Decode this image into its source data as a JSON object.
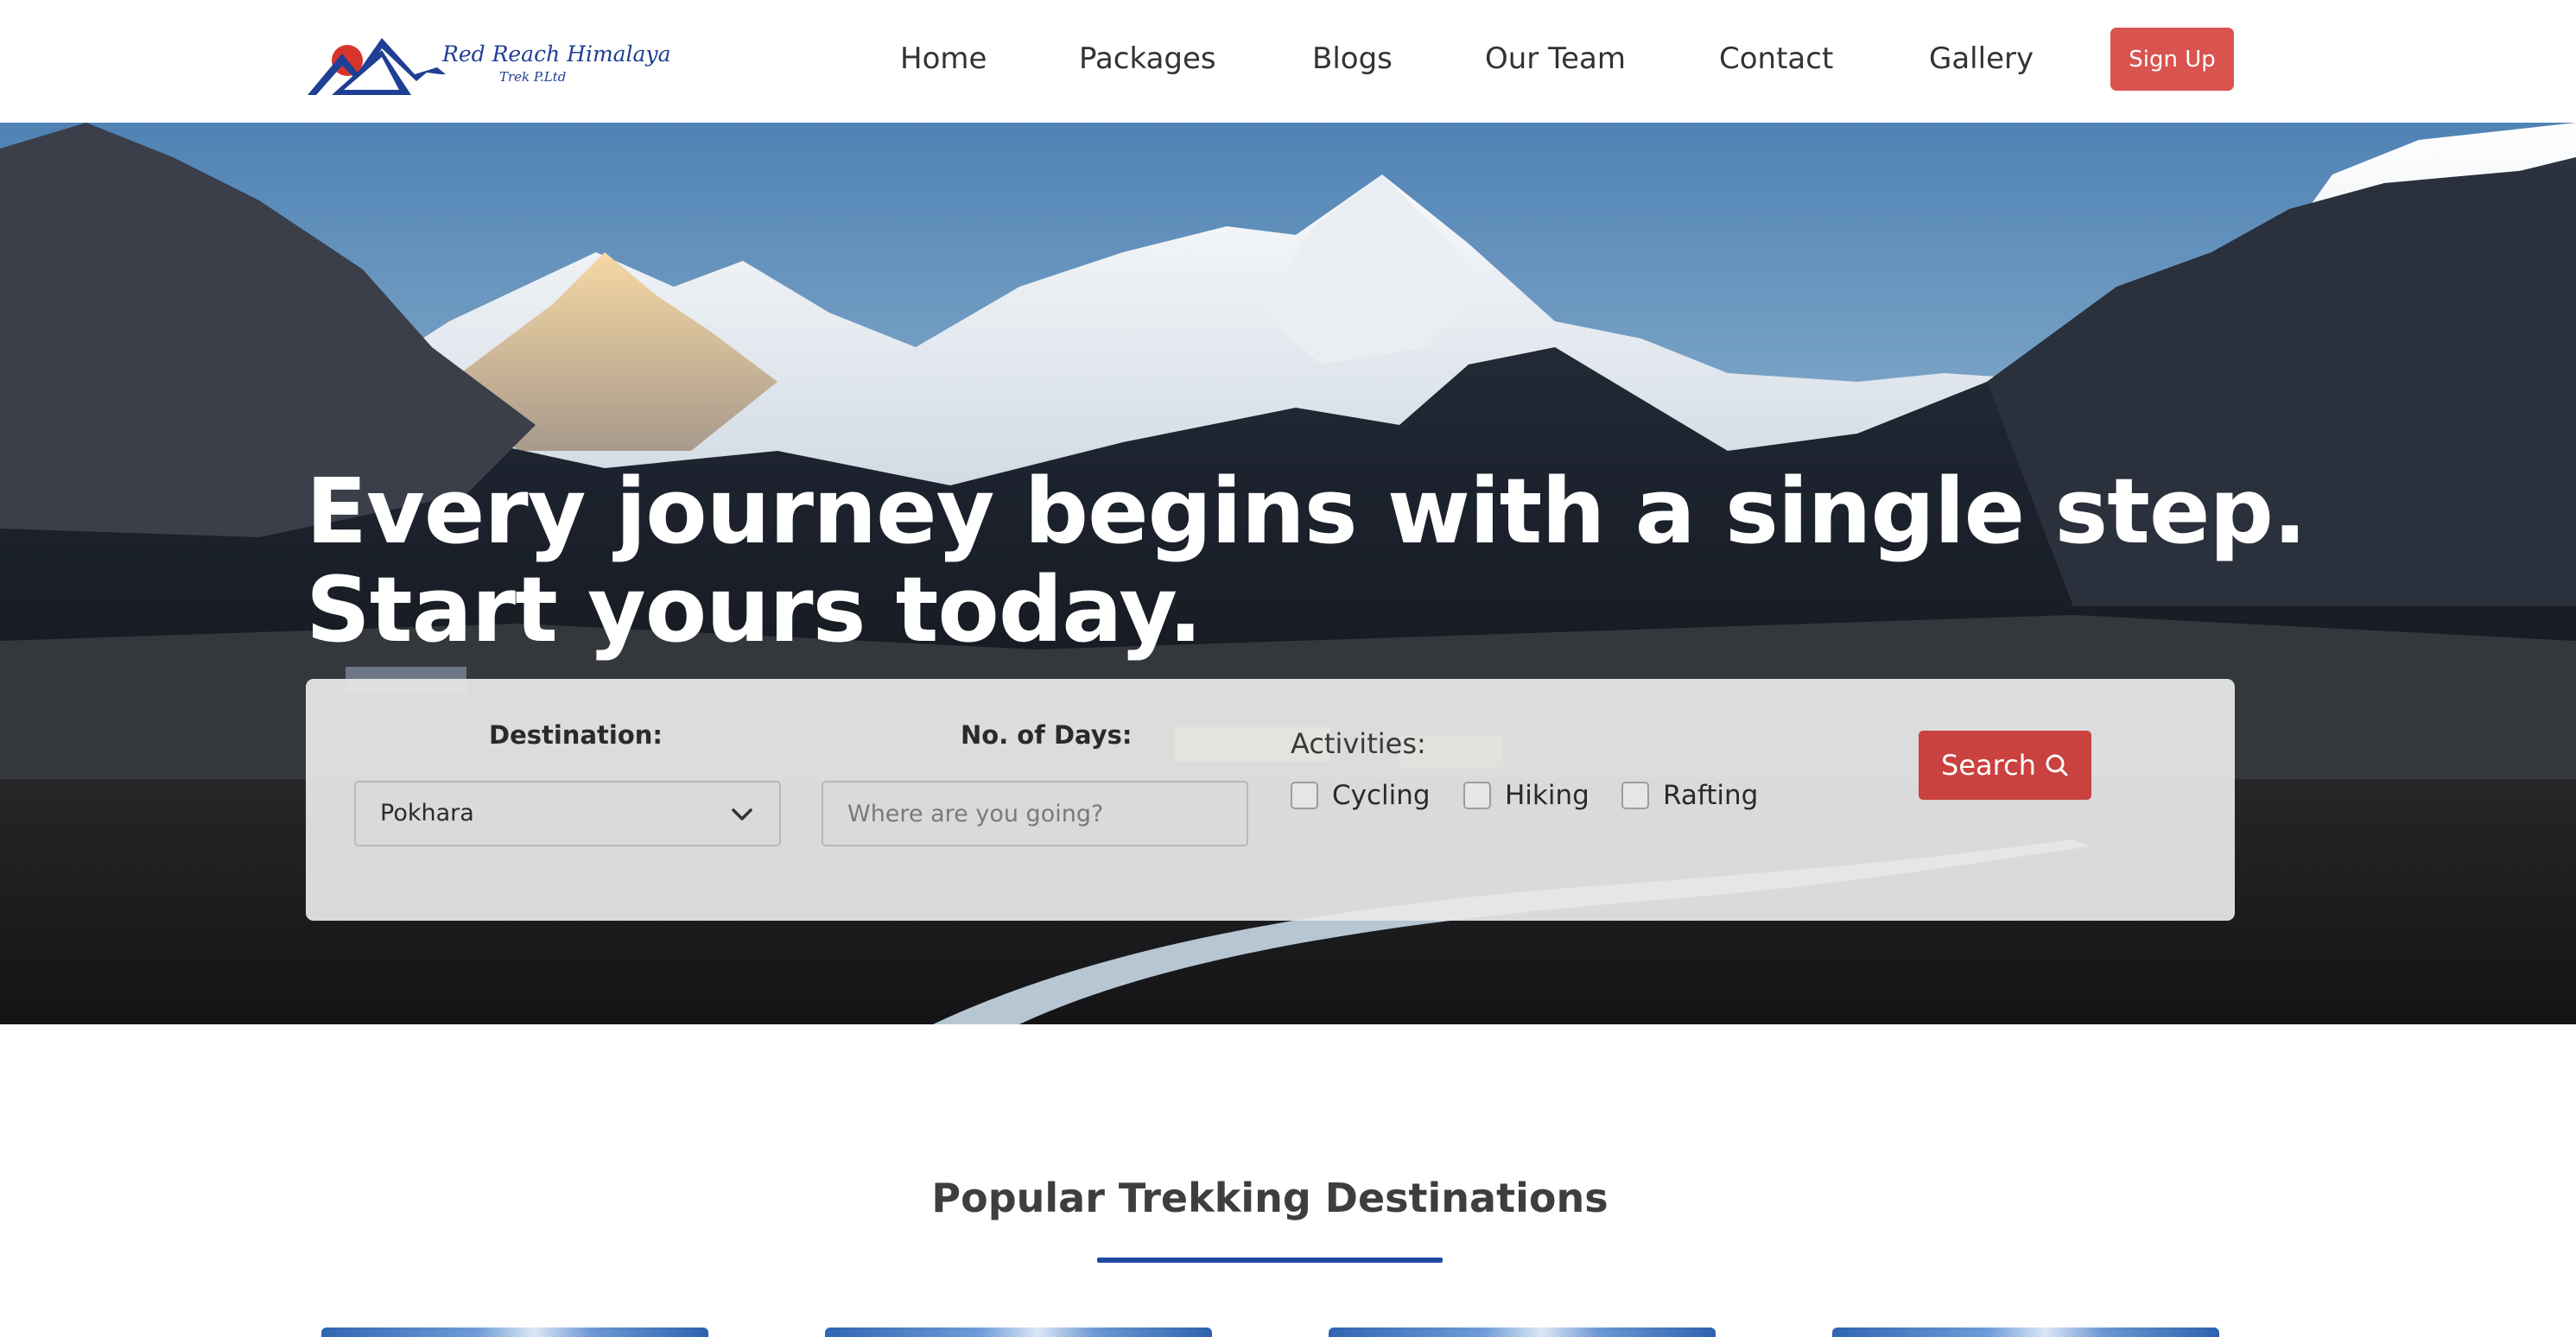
{
  "brand": {
    "name": "Red Reach Himalaya",
    "sub": "Trek P.Ltd"
  },
  "nav": {
    "items": [
      "Home",
      "Packages",
      "Blogs",
      "Our Team",
      "Contact",
      "Gallery"
    ],
    "signup": "Sign Up"
  },
  "hero": {
    "line1": "Every journey begins with a single step.",
    "line2": "Start yours today."
  },
  "search": {
    "destination_label": "Destination:",
    "destination_value": "Pokhara",
    "days_label": "No. of Days:",
    "days_placeholder": "Where are you going?",
    "activities_label": "Activities:",
    "activities": [
      {
        "label": "Cycling",
        "checked": false
      },
      {
        "label": "Hiking",
        "checked": false
      },
      {
        "label": "Rafting",
        "checked": false
      }
    ],
    "button_label": "Search",
    "button_icon": "search-icon"
  },
  "section": {
    "title": "Popular Trekking Destinations"
  },
  "colors": {
    "brand_red": "#d9534f",
    "search_red": "#c9423f",
    "accent_blue": "#1f4ba3",
    "logo_blue": "#1f3f95"
  }
}
